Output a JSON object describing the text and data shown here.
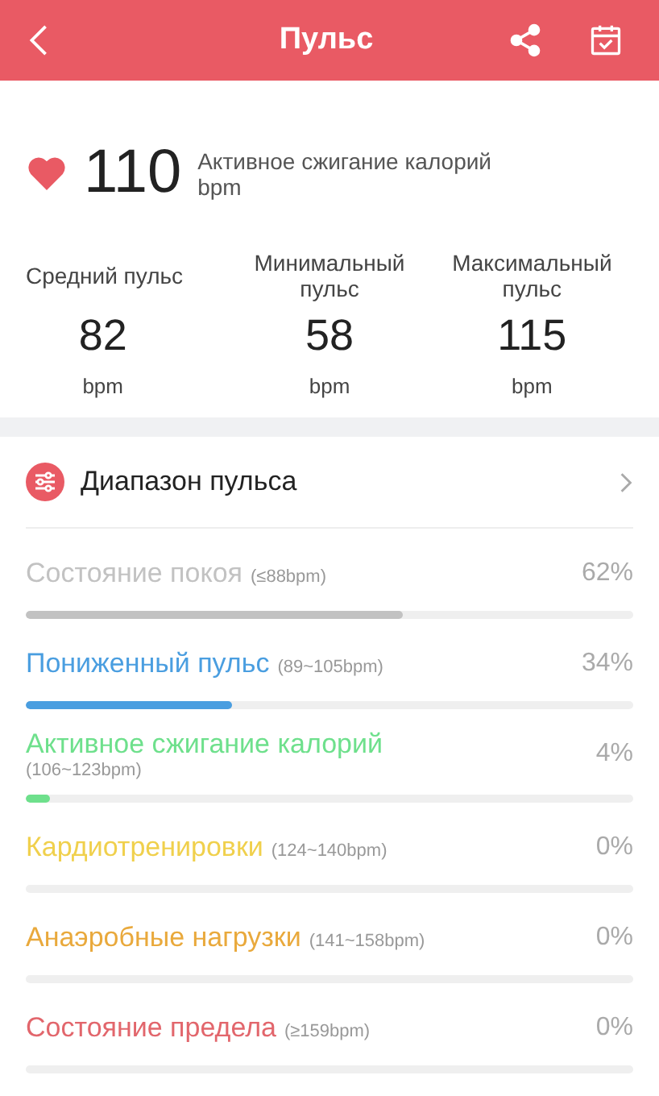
{
  "header": {
    "title": "Пульс"
  },
  "current": {
    "value": "110",
    "unit": "bpm",
    "zone": "Активное сжигание калорий"
  },
  "stats": [
    {
      "label": "Средний пульс",
      "value": "82",
      "unit": "bpm"
    },
    {
      "label": "Минимальный пульс",
      "value": "58",
      "unit": "bpm"
    },
    {
      "label": "Максимальный пульс",
      "value": "115",
      "unit": "bpm"
    }
  ],
  "range_section": {
    "title": "Диапазон пульса"
  },
  "zones": [
    {
      "name": "Состояние покоя",
      "range": "(≤88bpm)",
      "percent": "62%",
      "level": 0.62,
      "color": "#c2c2c2"
    },
    {
      "name": "Пониженный пульс",
      "range": "(89~105bpm)",
      "percent": "34%",
      "level": 0.34,
      "color": "#4a9ee0"
    },
    {
      "name": "Активное сжигание калорий",
      "range": "(106~123bpm)",
      "percent": "4%",
      "level": 0.04,
      "color": "#6ee08c"
    },
    {
      "name": "Кардиотренировки",
      "range": "(124~140bpm)",
      "percent": "0%",
      "level": 0,
      "color": "#f0d04c"
    },
    {
      "name": "Анаэробные нагрузки",
      "range": "(141~158bpm)",
      "percent": "0%",
      "level": 0,
      "color": "#e9a93c"
    },
    {
      "name": "Состояние предела",
      "range": "(≥159bpm)",
      "percent": "0%",
      "level": 0,
      "color": "#e2666c"
    }
  ]
}
